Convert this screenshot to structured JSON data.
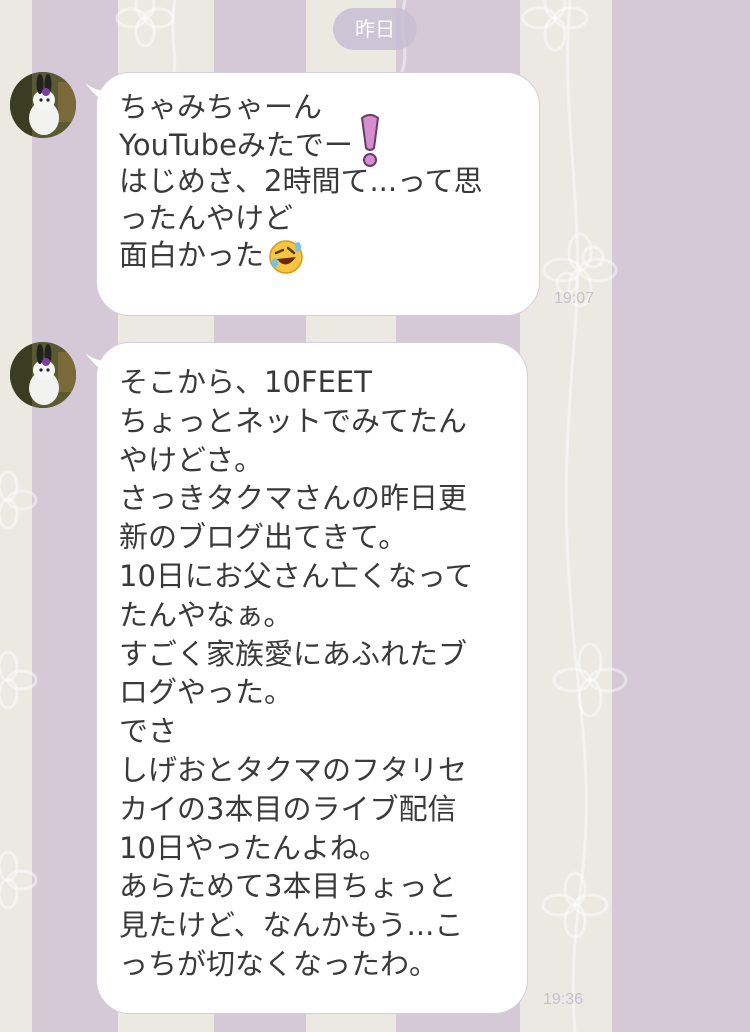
{
  "date_separator": "昨日",
  "messages": [
    {
      "sender_avatar": "rabbit-avatar",
      "lines": [
        "ちゃみちゃーん",
        "YouTubeみたでー",
        "はじめさ、2時間て...って思",
        "ったんやけど",
        "面白かった"
      ],
      "emojis": {
        "line_1": "pink-exclamation-icon",
        "line_4": "rofl-face-icon"
      },
      "time": "19:07"
    },
    {
      "sender_avatar": "rabbit-avatar",
      "lines": [
        "そこから、10FEET",
        "ちょっとネットでみてたん",
        "やけどさ。",
        "さっきタクマさんの昨日更",
        "新のブログ出てきて。",
        "10日にお父さん亡くなって",
        "たんやなぁ。",
        "すごく家族愛にあふれたブ",
        "ログやった。",
        "でさ",
        "しげおとタクマのフタリセ",
        "カイの3本目のライブ配信",
        "10日やったんよね。",
        "あらためて3本目ちょっと",
        "見たけど、なんかもう...こ",
        "っちが切なくなったわ。"
      ],
      "time": "19:36"
    }
  ],
  "colors": {
    "stripe_light": "#ece9e3",
    "stripe_purple": "#d6c9d7",
    "bubble_bg": "#ffffff",
    "text": "#3a3a3a",
    "timestamp": "#c7bfcc"
  }
}
